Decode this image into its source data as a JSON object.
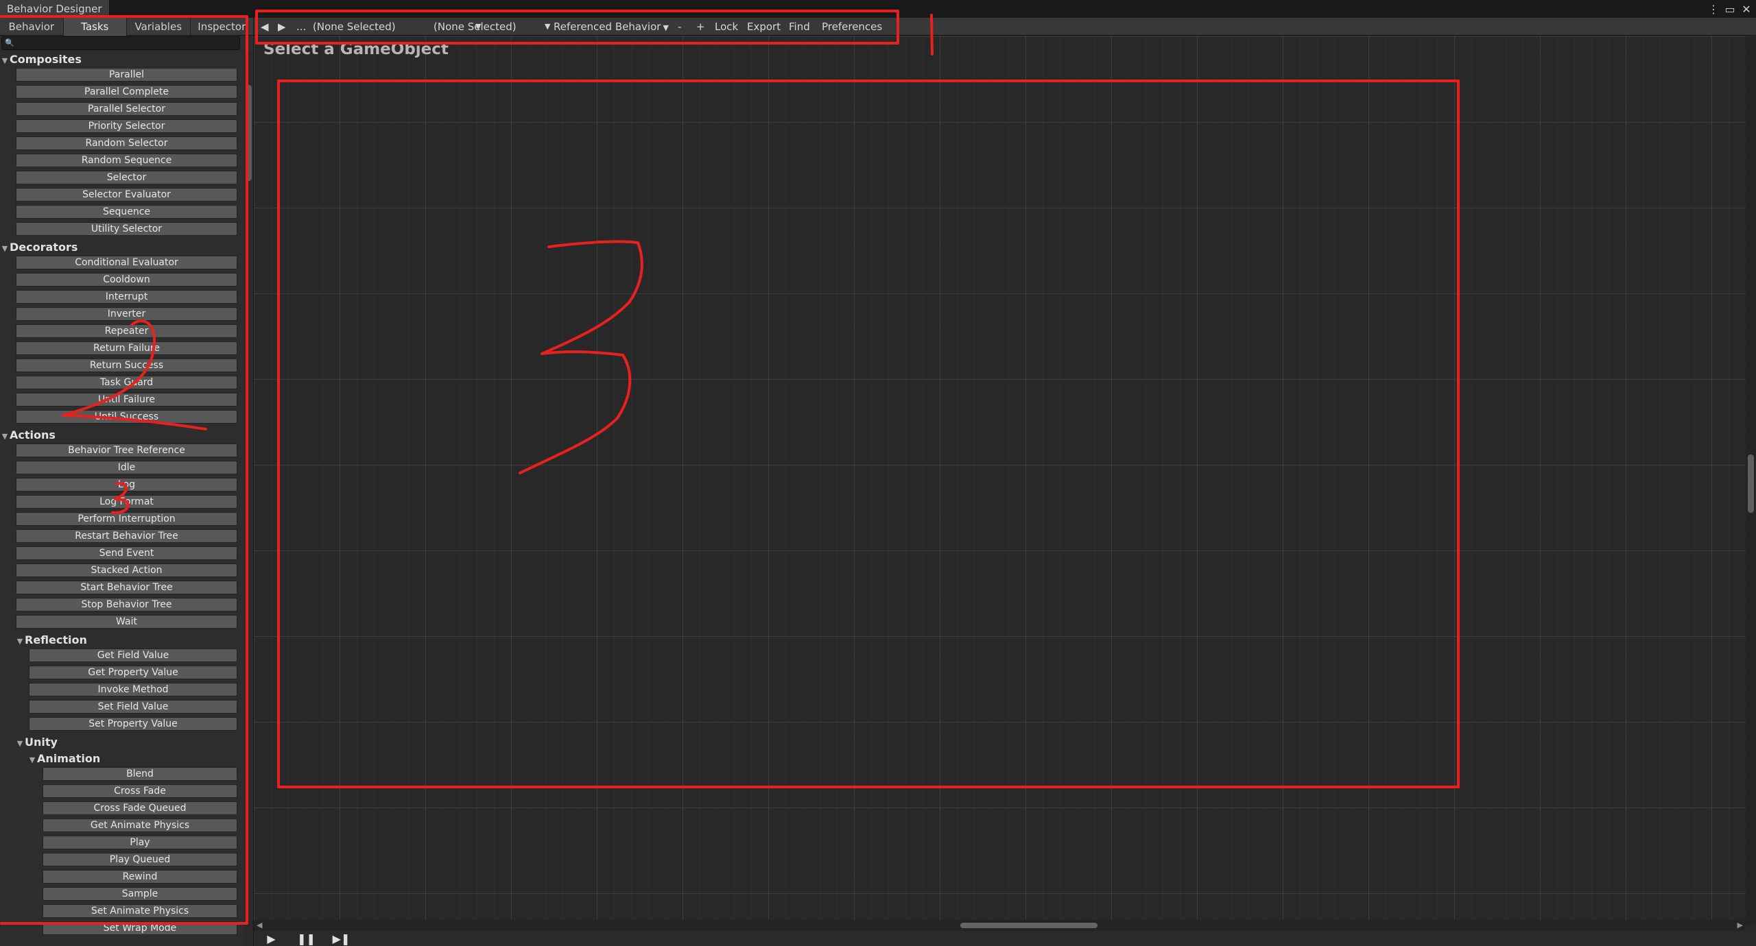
{
  "window": {
    "title": "Behavior Designer",
    "controls": [
      "⋮",
      "▭",
      "✕"
    ]
  },
  "tabs": [
    "Behavior",
    "Tasks",
    "Variables",
    "Inspector"
  ],
  "search": {
    "value": "",
    "placeholder": ""
  },
  "groups": {
    "composites": {
      "label": "Composites",
      "items": [
        "Parallel",
        "Parallel Complete",
        "Parallel Selector",
        "Priority Selector",
        "Random Selector",
        "Random Sequence",
        "Selector",
        "Selector Evaluator",
        "Sequence",
        "Utility Selector"
      ]
    },
    "decorators": {
      "label": "Decorators",
      "items": [
        "Conditional Evaluator",
        "Cooldown",
        "Interrupt",
        "Inverter",
        "Repeater",
        "Return Failure",
        "Return Success",
        "Task Guard",
        "Until Failure",
        "Until Success"
      ]
    },
    "actions": {
      "label": "Actions",
      "items": [
        "Behavior Tree Reference",
        "Idle",
        "Log",
        "Log Format",
        "Perform Interruption",
        "Restart Behavior Tree",
        "Send Event",
        "Stacked Action",
        "Start Behavior Tree",
        "Stop Behavior Tree",
        "Wait"
      ]
    },
    "reflection": {
      "label": "Reflection",
      "items": [
        "Get Field Value",
        "Get Property Value",
        "Invoke Method",
        "Set Field Value",
        "Set Property Value"
      ]
    },
    "unity": {
      "label": "Unity"
    },
    "animation": {
      "label": "Animation",
      "items": [
        "Blend",
        "Cross Fade",
        "Cross Fade Queued",
        "Get Animate Physics",
        "Play",
        "Play Queued",
        "Rewind",
        "Sample",
        "Set Animate Physics",
        "Set Wrap Mode"
      ]
    }
  },
  "toolbar": {
    "back": "◀",
    "forward": "▶",
    "more": "...",
    "dropdown1": "(None Selected)",
    "dropdown2": "(None Selected)",
    "referenced": "Referenced Behavior",
    "minus": "-",
    "plus": "+",
    "lock": "Lock",
    "export": "Export",
    "find": "Find",
    "preferences": "Preferences"
  },
  "canvas": {
    "message": "Select a GameObject"
  },
  "playbar": {
    "play": "▶",
    "pause": "❚❚",
    "step": "▶❚"
  },
  "annotation": {
    "color": "#e8211f"
  }
}
